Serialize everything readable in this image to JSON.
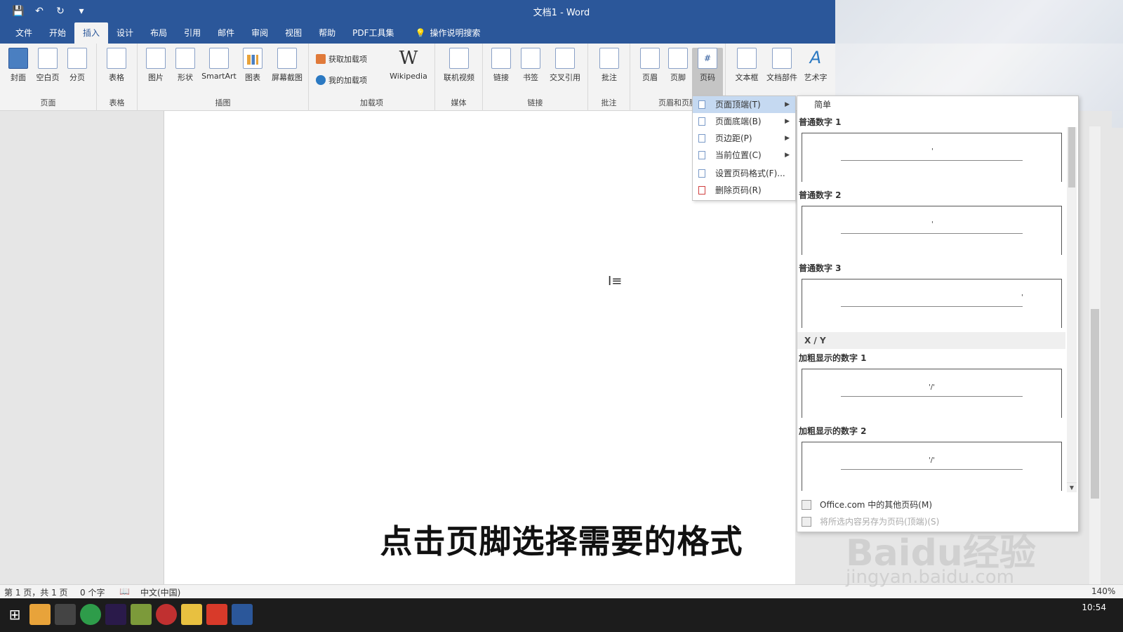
{
  "window": {
    "title": "文档1  -  Word"
  },
  "tabs": [
    "文件",
    "开始",
    "插入",
    "设计",
    "布局",
    "引用",
    "邮件",
    "审阅",
    "视图",
    "帮助",
    "PDF工具集"
  ],
  "active_tab": "插入",
  "tellme": "操作说明搜索",
  "ribbon": {
    "groups": {
      "pages": "页面",
      "table": "表格",
      "illustrations": "插图",
      "addins": "加载项",
      "media": "媒体",
      "links": "链接",
      "comments": "批注",
      "header_footer": "页眉和页脚"
    },
    "buttons": {
      "cover": "封面",
      "blank": "空白页",
      "break": "分页",
      "table": "表格",
      "picture": "图片",
      "shape": "形状",
      "smartart": "SmartArt",
      "chart": "图表",
      "screenshot": "屏幕截图",
      "get_addins": "获取加载项",
      "my_addins": "我的加载项",
      "wikipedia": "Wikipedia",
      "online_video": "联机视频",
      "link": "链接",
      "bookmark": "书签",
      "crossref": "交叉引用",
      "comment": "批注",
      "header": "页眉",
      "footer": "页脚",
      "page_number": "页码",
      "textbox": "文本框",
      "docparts": "文档部件",
      "wordart": "艺术字"
    }
  },
  "page_menu": {
    "items": [
      {
        "label": "页面顶端(T)",
        "highlighted": true,
        "submenu": true
      },
      {
        "label": "页面底端(B)",
        "highlighted": false,
        "submenu": true
      },
      {
        "label": "页边距(P)",
        "highlighted": false,
        "submenu": true
      },
      {
        "label": "当前位置(C)",
        "highlighted": false,
        "submenu": true
      },
      {
        "label": "设置页码格式(F)...",
        "highlighted": false,
        "submenu": false
      },
      {
        "label": "删除页码(R)",
        "highlighted": false,
        "submenu": false
      }
    ]
  },
  "gallery": {
    "header": "简单",
    "items": [
      {
        "label": "普通数字 1",
        "align": "center",
        "mark": "'"
      },
      {
        "label": "普通数字 2",
        "align": "center",
        "mark": "'"
      },
      {
        "label": "普通数字 3",
        "align": "right",
        "mark": "'"
      }
    ],
    "section": "X / Y",
    "bold_items": [
      {
        "label": "加粗显示的数字 1",
        "mark": "'/'"
      },
      {
        "label": "加粗显示的数字 2",
        "mark": "'/'"
      }
    ],
    "footer_more": "Office.com 中的其他页码(M)",
    "footer_save": "将所选内容另存为页码(顶端)(S)"
  },
  "statusbar": {
    "page": "第 1 页，共 1 页",
    "words": "0 个字",
    "lang": "中文(中国)",
    "zoom": "140%"
  },
  "taskbar": {
    "time": "10:54"
  },
  "subtitle": "点击页脚选择需要的格式",
  "watermark": {
    "brand": "Bai",
    "brand2": "du",
    "suffix": "经验",
    "url": "jingyan.baidu.com"
  },
  "colors": {
    "accent": "#2b579a",
    "highlight": "#c5d9f1"
  }
}
